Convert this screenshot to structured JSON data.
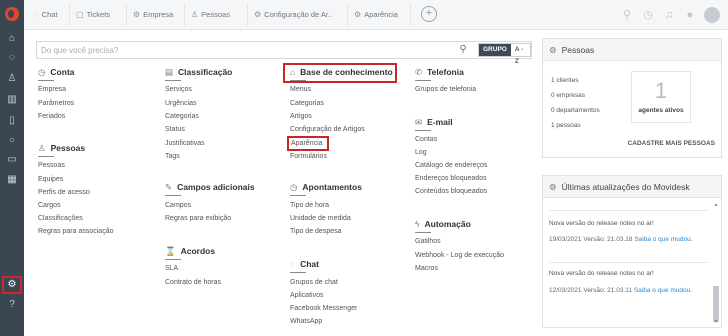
{
  "sidebar": {
    "icons": [
      "home-icon",
      "chat-icon",
      "people-icon",
      "chart-icon",
      "document-icon",
      "search-icon",
      "inbox-icon",
      "calendar-icon",
      "settings-icon",
      "help-icon"
    ]
  },
  "tabs": [
    {
      "icon": "chat-icon",
      "label": "Chat"
    },
    {
      "icon": "ticket-icon",
      "label": "Tickets"
    },
    {
      "icon": "company-icon",
      "label": "Empresa"
    },
    {
      "icon": "people-icon",
      "label": "Pessoas"
    },
    {
      "icon": "settings-icon",
      "label": "Configuração de Ar.."
    },
    {
      "icon": "appearance-icon",
      "label": "Aparência"
    }
  ],
  "search": {
    "placeholder": "Do que você precisa?",
    "toggle_group": "GRUPO",
    "toggle_az": "A - Z"
  },
  "catalog": {
    "conta": {
      "title": "Conta",
      "items": [
        "Empresa",
        "Parâmetros",
        "Feriados"
      ]
    },
    "pessoas": {
      "title": "Pessoas",
      "items": [
        "Pessoas",
        "Equipes",
        "Perfis de acesso",
        "Cargos",
        "Classificações",
        "Regras para associação"
      ]
    },
    "classificacao": {
      "title": "Classificação",
      "items": [
        "Serviços",
        "Urgências",
        "Categorias",
        "Status",
        "Justificativas",
        "Tags"
      ]
    },
    "campos": {
      "title": "Campos adicionais",
      "items": [
        "Campos",
        "Regras para exibição"
      ]
    },
    "acordos": {
      "title": "Acordos",
      "items": [
        "SLA",
        "Contrato de horas"
      ]
    },
    "base": {
      "title": "Base de conhecimento",
      "items": [
        "Menus",
        "Categorias",
        "Artigos",
        "Configuração de Artigos",
        "Aparência",
        "Formulários"
      ]
    },
    "apontamentos": {
      "title": "Apontamentos",
      "items": [
        "Tipo de hora",
        "Unidade de medida",
        "Tipo de despesa"
      ]
    },
    "chat": {
      "title": "Chat",
      "items": [
        "Grupos de chat",
        "Aplicativos",
        "Facebook Messenger",
        "WhatsApp"
      ]
    },
    "telefonia": {
      "title": "Telefonia",
      "items": [
        "Grupos de telefonia"
      ]
    },
    "email": {
      "title": "E-mail",
      "items": [
        "Contas",
        "Log",
        "Catálogo de endereços",
        "Endereços bloqueados",
        "Conteúdos bloqueados"
      ]
    },
    "automacao": {
      "title": "Automação",
      "items": [
        "Gatilhos",
        "Webhook - Log de execução",
        "Macros"
      ]
    }
  },
  "pessoas_panel": {
    "title": "Pessoas",
    "stats": [
      "1 clientes",
      "0 empresas",
      "0 departamentos",
      "1 pessoas"
    ],
    "agents_count": "1",
    "agents_label": "agentes ativos",
    "cta": "CADASTRE MAIS PESSOAS"
  },
  "updates_panel": {
    "title": "Últimas atualizações do Movidesk",
    "news": [
      {
        "title": "Nova versão do release notes no ar!",
        "meta": "19/03/2021 Versão: 21.03.18",
        "link": "Saiba o que mudou."
      },
      {
        "title": "Nova versão do release notes no ar!",
        "meta": "12/03/2021 Versão: 21.03.11",
        "link": "Saiba o que mudou."
      }
    ]
  },
  "colors": {
    "sidebar_bg": "#3a4652",
    "highlight": "#c62828",
    "link": "#2a8ad6",
    "logo": "#e2472a"
  }
}
